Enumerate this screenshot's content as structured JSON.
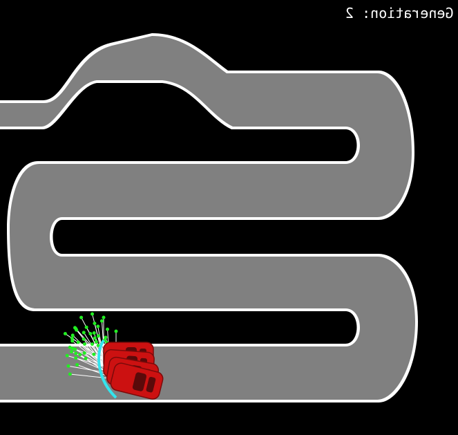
{
  "hud": {
    "generation_label": "Generation: ",
    "generation_value": "2"
  },
  "track": {
    "background_color": "#000000",
    "road_color": "#808080",
    "border_color": "#ffffff"
  },
  "population": {
    "car_color": "#cc1111",
    "car_window_color": "#5a0a0a",
    "radar_line_color": "#ffffff",
    "radar_hit_color": "#22ee22",
    "collision_color": "#33e5ee",
    "cars_alive": 4
  },
  "icons": {
    "car": "race-car-icon",
    "sensor": "radar-ray"
  }
}
